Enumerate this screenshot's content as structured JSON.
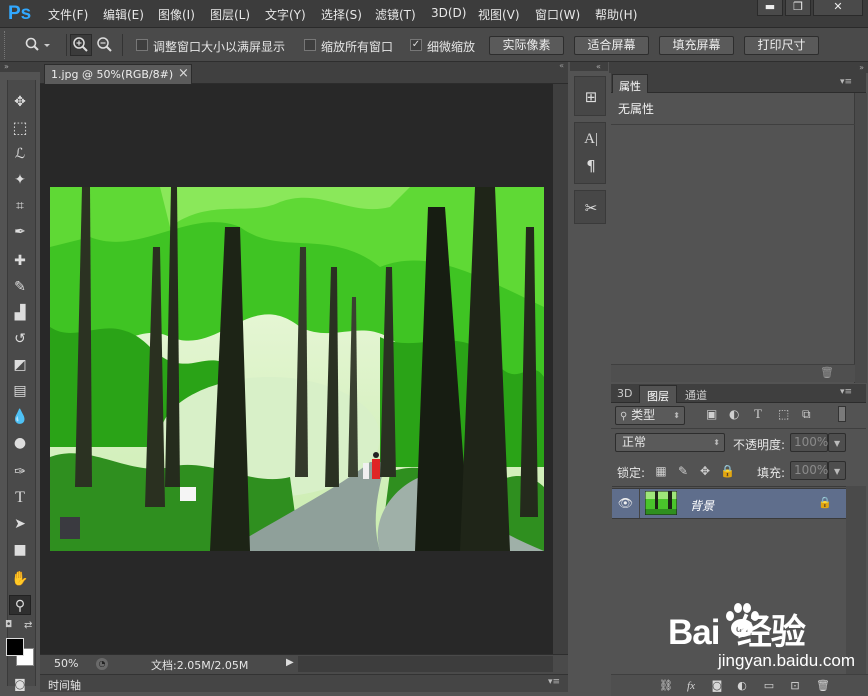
{
  "app": {
    "logo": "Ps",
    "accent": "#31a8ff"
  },
  "menu": [
    "文件(F)",
    "编辑(E)",
    "图像(I)",
    "图层(L)",
    "文字(Y)",
    "选择(S)",
    "滤镜(T)",
    "3D(D)",
    "视图(V)",
    "窗口(W)",
    "帮助(H)"
  ],
  "window_controls": {
    "minimize": "▬",
    "restore": "❐",
    "close": "✕"
  },
  "options": {
    "resize_windows": {
      "label": "调整窗口大小以满屏显示",
      "checked": false
    },
    "zoom_all": {
      "label": "缩放所有窗口",
      "checked": false
    },
    "scrubby_zoom": {
      "label": "细微缩放",
      "checked": true,
      "mark": "✓"
    },
    "buttons": [
      "实际像素",
      "适合屏幕",
      "填充屏幕",
      "打印尺寸"
    ]
  },
  "document": {
    "tab_title": "1.jpg @ 50%(RGB/8#)",
    "close": "×",
    "zoom": "50%",
    "doc_info": "文档:2.05M/2.05M",
    "timeline_label": "时间轴"
  },
  "properties": {
    "tab": "属性",
    "content": "无属性"
  },
  "layers_panel": {
    "tabs": [
      "3D",
      "图层",
      "通道"
    ],
    "filter_kind": "类型",
    "blend_mode": "正常",
    "opacity_label": "不透明度:",
    "opacity_value": "100%",
    "lock_label": "锁定:",
    "fill_label": "填充:",
    "fill_value": "100%",
    "layer_name": "背景"
  },
  "watermark": {
    "logo_text": "Bai  经验",
    "url": "jingyan.baidu.com"
  },
  "colors": {
    "foreground": "#000000",
    "background": "#ffffff",
    "selected_layer": "#5f6e8c"
  }
}
